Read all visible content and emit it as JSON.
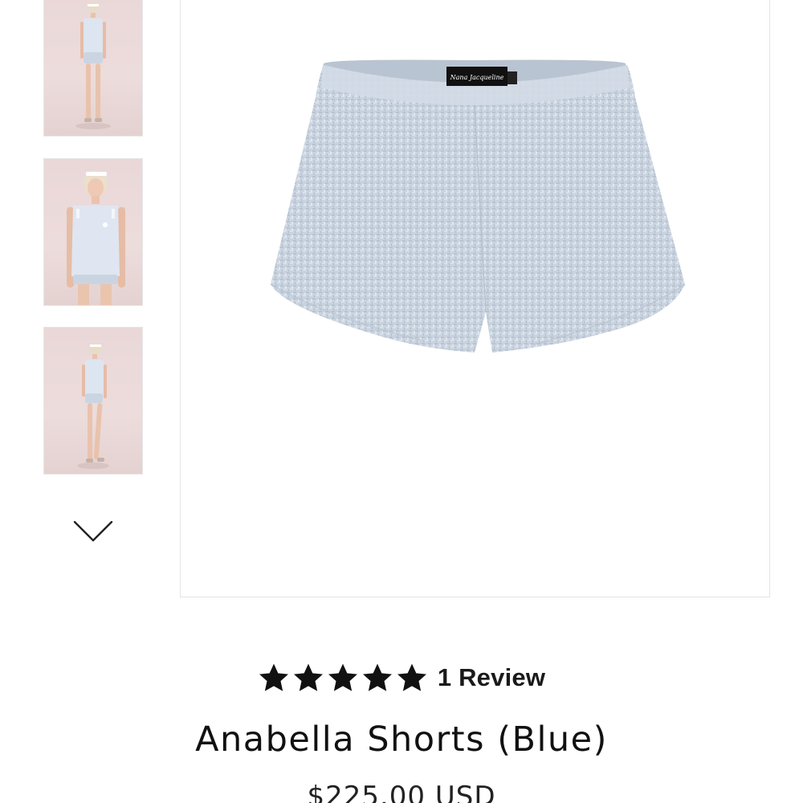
{
  "thumbnails": [
    {
      "alt": "model front full length"
    },
    {
      "alt": "model close-up"
    },
    {
      "alt": "model side full length"
    }
  ],
  "thumbnail_scroll_icon": "chevron-down-icon",
  "main_image": {
    "label_text": "Nana Jacqueline",
    "fabric_color": "#c9d3df"
  },
  "rating": {
    "stars": 5,
    "max": 5,
    "review_label": "1 Review"
  },
  "product": {
    "title": "Anabella Shorts (Blue)",
    "price": "$225.00 USD"
  },
  "colors": {
    "star": "#111111",
    "text": "#111111",
    "border": "#e3e3e3"
  }
}
